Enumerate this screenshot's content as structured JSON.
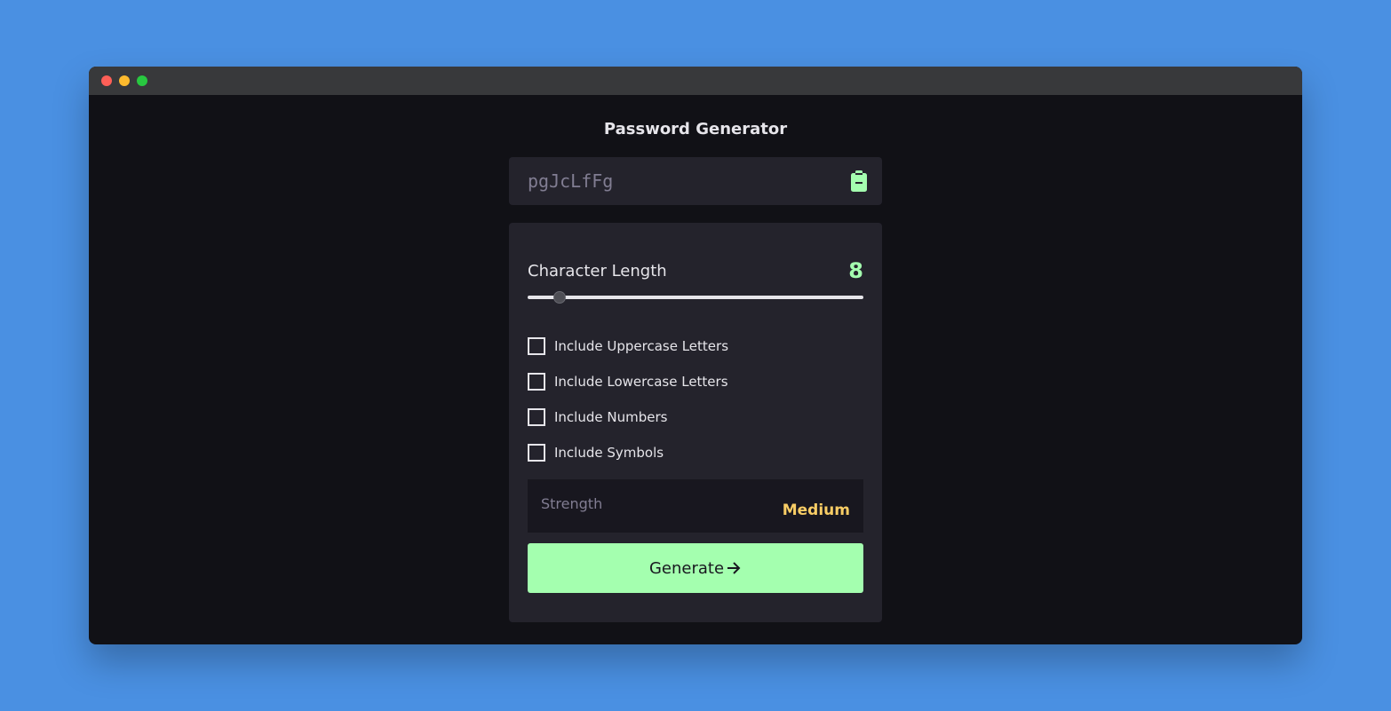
{
  "app": {
    "title": "Password Generator"
  },
  "output": {
    "password": "pgJcLfFg"
  },
  "length": {
    "label": "Character Length",
    "value": "8",
    "slider_fraction": 0.095
  },
  "options": [
    {
      "label": "Include Uppercase Letters",
      "checked": false
    },
    {
      "label": "Include Lowercase Letters",
      "checked": false
    },
    {
      "label": "Include Numbers",
      "checked": false
    },
    {
      "label": "Include Symbols",
      "checked": false
    }
  ],
  "strength": {
    "label": "Strength",
    "value": "Medium"
  },
  "generate": {
    "label": "Generate"
  },
  "icons": {
    "copy": "clipboard-icon",
    "arrow": "arrow-right-icon"
  },
  "colors": {
    "accent": "#a4ffaf",
    "strength_medium": "#f8cd65",
    "panel": "#24232c",
    "background": "#111116"
  }
}
